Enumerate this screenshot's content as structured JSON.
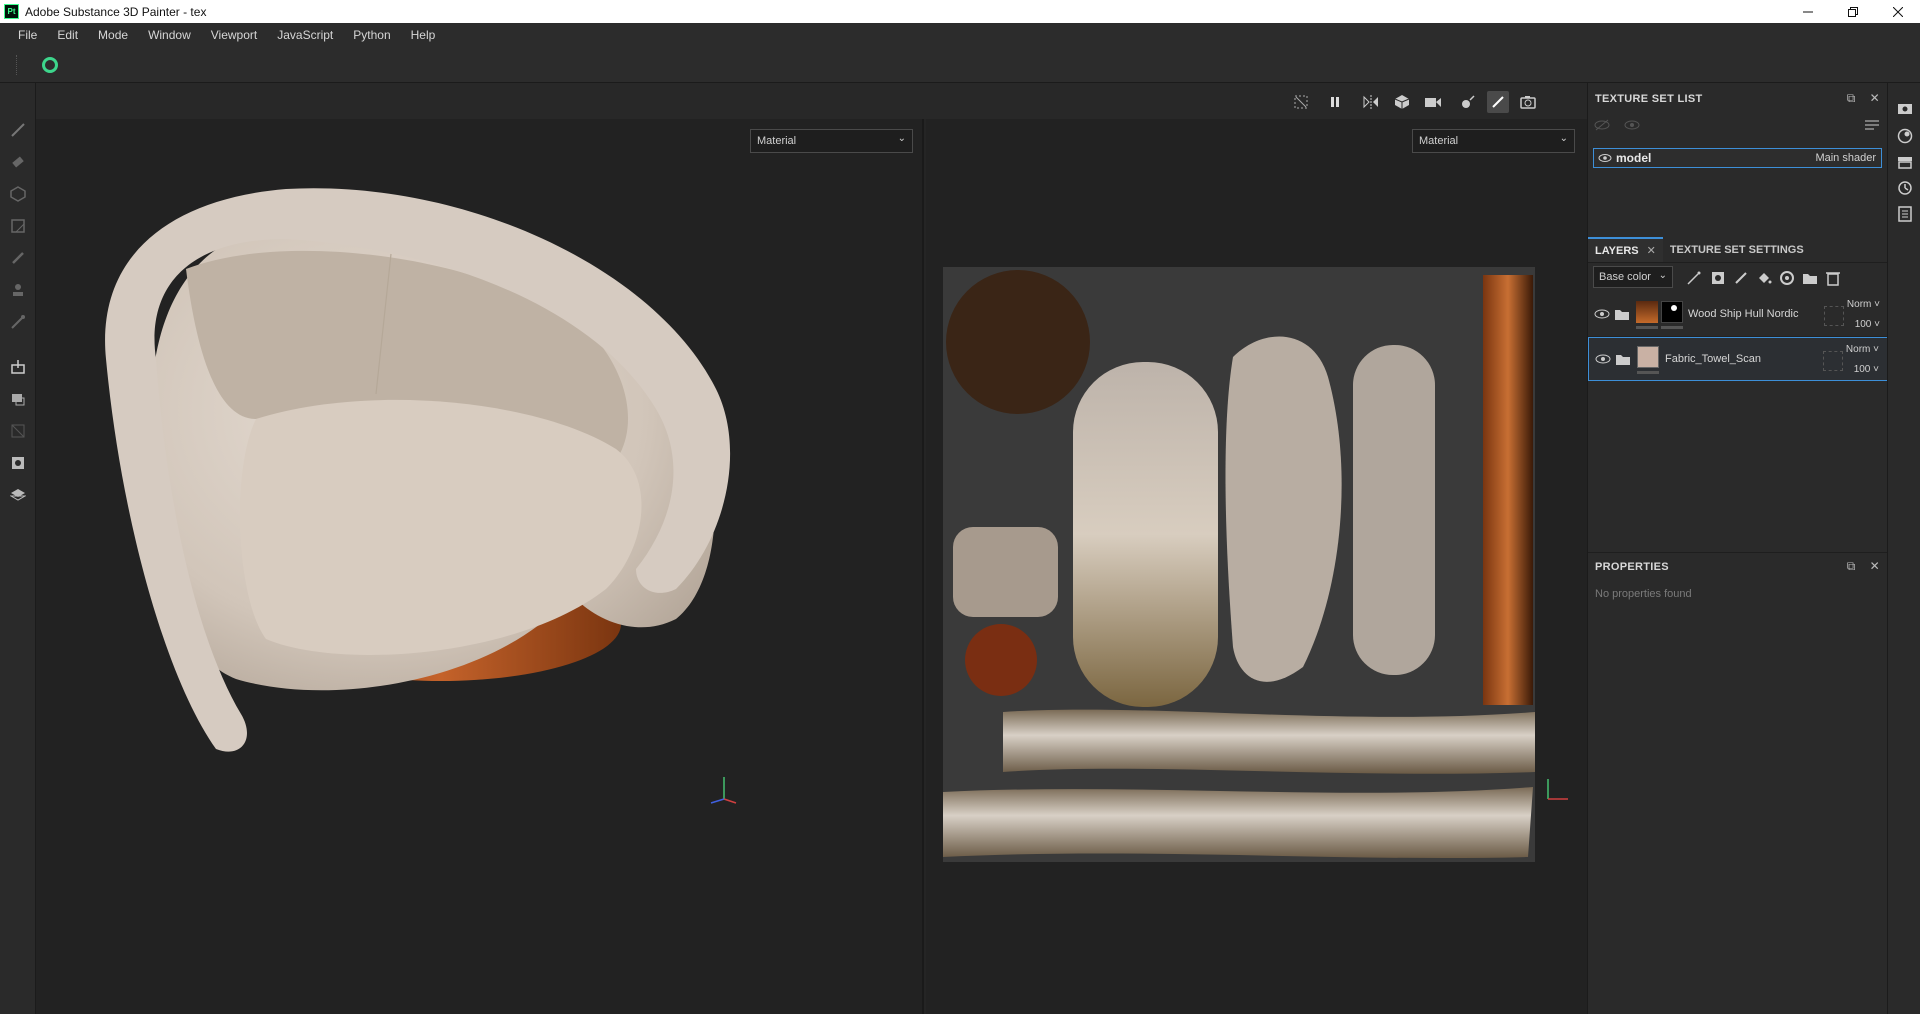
{
  "window": {
    "title": "Adobe Substance 3D Painter - tex",
    "logo_text": "Pt",
    "controls": [
      "minimize",
      "restore",
      "close"
    ]
  },
  "menu": [
    "File",
    "Edit",
    "Mode",
    "Window",
    "Viewport",
    "JavaScript",
    "Python",
    "Help"
  ],
  "left_tools": [
    "paint-brush-icon",
    "eraser-icon",
    "projection-icon",
    "geometry-mask-icon",
    "smudge-icon",
    "clone-stamp-icon",
    "color-picker-icon",
    "bake-export-icon",
    "fill-projection-icon",
    "polygon-fill-icon",
    "mesh-map-icon",
    "uv-tile-icon"
  ],
  "viewport_toolbar": [
    "screenshot-off-icon",
    "pause-icon",
    "symmetry-icon",
    "camera-projection-icon",
    "camera-icon",
    "bake-light-icon",
    "paint-brush-icon",
    "camera-capture-icon"
  ],
  "viewport_3d": {
    "mode_select": "Material"
  },
  "viewport_2d": {
    "mode_select": "Material"
  },
  "texture_set_list": {
    "title": "TEXTURE SET LIST",
    "items": [
      {
        "name": "model",
        "shader": "Main shader"
      }
    ]
  },
  "layers": {
    "tab_label": "LAYERS",
    "settings_tab_label": "TEXTURE SET SETTINGS",
    "channel": "Base color",
    "items": [
      {
        "name": "Wood Ship Hull Nordic",
        "blend": "Norm",
        "opacity": "100",
        "selected": false
      },
      {
        "name": "Fabric_Towel_Scan",
        "blend": "Norm",
        "opacity": "100",
        "selected": true
      }
    ]
  },
  "properties": {
    "title": "PROPERTIES",
    "empty_text": "No properties found"
  },
  "right_strip": [
    "display-settings-icon",
    "environment-icon",
    "shelf-icon",
    "history-icon",
    "log-icon"
  ],
  "colors": {
    "accent": "#3d8fd8",
    "logo_green": "#3dff8e",
    "panel_bg": "#2a2a2a",
    "viewport_bg": "#222222"
  }
}
